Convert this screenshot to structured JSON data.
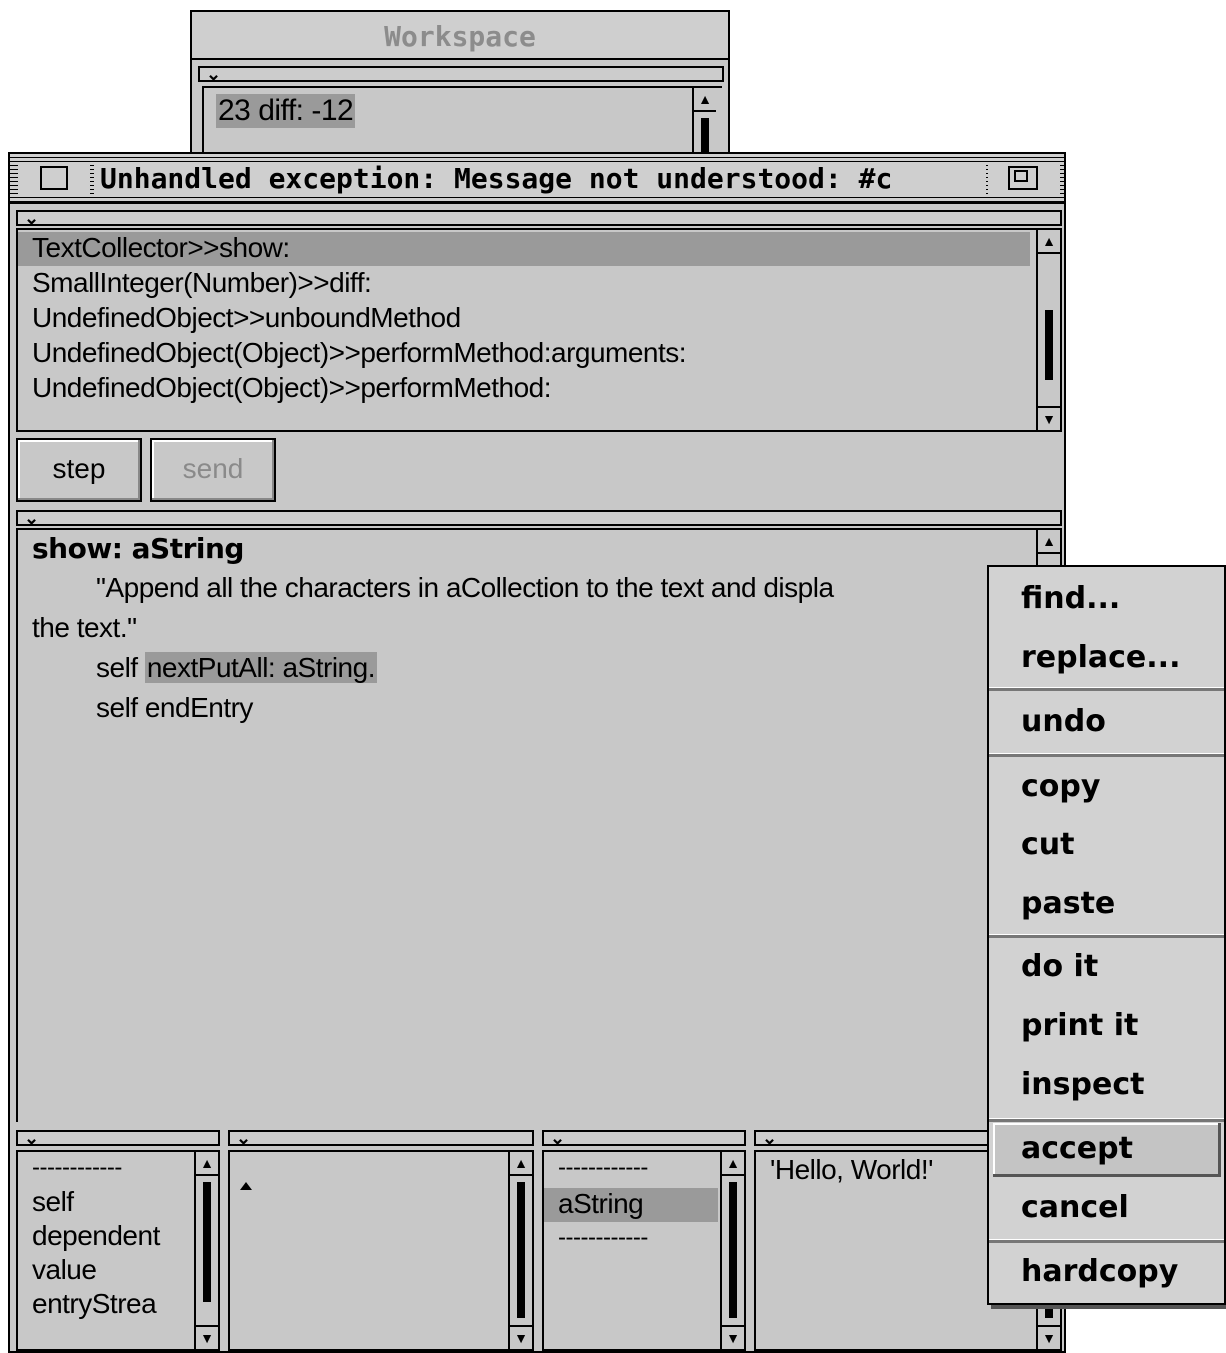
{
  "workspace": {
    "title": "Workspace",
    "content": "23 diff: -12"
  },
  "debugger": {
    "title": "Unhandled exception: Message not understood: #c",
    "stack": [
      "TextCollector>>show:",
      "SmallInteger(Number)>>diff:",
      "UndefinedObject>>unboundMethod",
      "UndefinedObject(Object)>>performMethod:arguments:",
      "UndefinedObject(Object)>>performMethod:"
    ],
    "buttons": {
      "step": "step",
      "send": "send"
    },
    "code": {
      "header": "show: aString",
      "comment_line1": "\"Append all the characters in aCollection to the text and displa",
      "comment_line2": "the text.\"",
      "line3_prefix": "self ",
      "line3_highlight": "nextPutAll: aString.",
      "line4": "self endEntry"
    },
    "receiver_vars": {
      "separator": "------------",
      "items": [
        "self",
        "dependent",
        "value",
        "entryStrea"
      ]
    },
    "temp_vars": {
      "separator_top": "------------",
      "selected": "aString",
      "separator_bottom": "------------"
    },
    "value_pane": "'Hello, World!'"
  },
  "context_menu": {
    "items": [
      "find...",
      "replace...",
      "undo",
      "copy",
      "cut",
      "paste",
      "do it",
      "print it",
      "inspect",
      "accept",
      "cancel",
      "hardcopy"
    ]
  }
}
